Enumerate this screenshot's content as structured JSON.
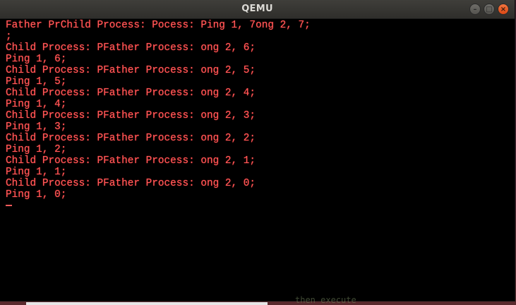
{
  "window": {
    "title": "QEMU",
    "minimize_icon": "minimize-icon",
    "maximize_icon": "maximize-icon",
    "close_icon": "close-icon"
  },
  "terminal": {
    "text_color": "#ff5a5a",
    "lines": [
      "Father PrChild Process: Pocess: Ping 1, 7ong 2, 7;",
      ";",
      "Child Process: PFather Process: ong 2, 6;",
      "Ping 1, 6;",
      "Child Process: PFather Process: ong 2, 5;",
      "Ping 1, 5;",
      "Child Process: PFather Process: ong 2, 4;",
      "Ping 1, 4;",
      "Child Process: PFather Process: ong 2, 3;",
      "Ping 1, 3;",
      "Child Process: PFather Process: ong 2, 2;",
      "Ping 1, 2;",
      "Child Process: PFather Process: ong 2, 1;",
      "Ping 1, 1;",
      "Child Process: PFather Process: ong 2, 0;",
      "Ping 1, 0;"
    ]
  },
  "background_fragment": "then execute"
}
